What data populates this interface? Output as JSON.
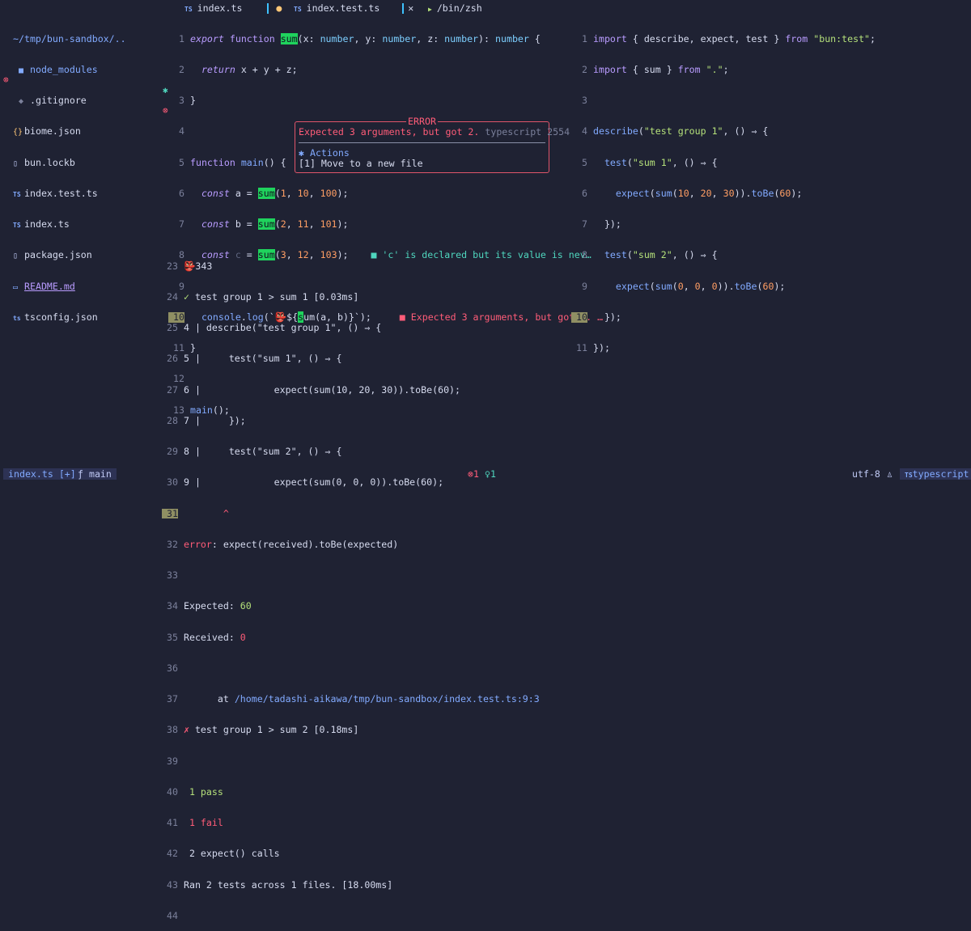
{
  "colors": {
    "background": "#1f2233",
    "error": "#ff5c78",
    "accent": "#82aaff",
    "match_highlight": "#1fd35d"
  },
  "file_tree": {
    "root": "~/tmp/bun-sandbox/..",
    "items": [
      {
        "name": "node_modules",
        "icon": "folder-icon"
      },
      {
        "name": ".gitignore",
        "icon": "git-icon"
      },
      {
        "name": "biome.json",
        "icon": "json-icon"
      },
      {
        "name": "bun.lockb",
        "icon": "file-icon"
      },
      {
        "name": "index.test.ts",
        "icon": "typescript-icon"
      },
      {
        "name": "index.ts",
        "icon": "typescript-icon"
      },
      {
        "name": "package.json",
        "icon": "file-icon"
      },
      {
        "name": "README.md",
        "icon": "markdown-icon"
      },
      {
        "name": "tsconfig.json",
        "icon": "typescript-icon"
      }
    ]
  },
  "tabs": [
    {
      "badge": "TS",
      "label": "index.ts",
      "modified": "●"
    },
    {
      "badge": "TS",
      "label": "index.test.ts",
      "close": "✕"
    },
    {
      "badge": "▶",
      "label": "/bin/zsh"
    }
  ],
  "editor_main": {
    "lines": {
      "n1": "1",
      "n2": "2",
      "n3": "3",
      "n4": "4",
      "n5": "5",
      "n6": "6",
      "n7": "7",
      "n8": "8",
      "n9": "9",
      "n10": "10",
      "n11": "11",
      "n12": "12",
      "n13": "13"
    },
    "diagnostics": {
      "hint": "■ 'c' is declared but its value is nev…",
      "error": "■ Expected 3 arguments, but got 2. …"
    }
  },
  "editor_test": {
    "lines": {
      "n1": "1",
      "n2": "2",
      "n3": "3",
      "n4": "4",
      "n5": "5",
      "n6": "6",
      "n7": "7",
      "n8": "8",
      "n9": "9",
      "n10": "10",
      "n11": "11"
    }
  },
  "popup": {
    "title": "ERROR",
    "message": "Expected 3 arguments, but got 2.",
    "source": "typescript 2554",
    "actions_label": "Actions",
    "action_1": "[1] Move to a new file"
  },
  "terminal": {
    "line_numbers": [
      "23",
      "24",
      "25",
      "26",
      "27",
      "28",
      "29",
      "30",
      "31",
      "32",
      "33",
      "34",
      "35",
      "36",
      "37",
      "38",
      "39",
      "40",
      "41",
      "42",
      "43",
      "44"
    ],
    "output_343": "343",
    "pass_test": "test group 1 > sum 1 [0.03ms]",
    "code_4": "4 | describe(\"test group 1\", () ⇒ {",
    "code_5": "5 |     test(\"sum 1\", () ⇒ {",
    "code_6": "6 |             expect(sum(10, 20, 30)).toBe(60);",
    "code_7": "7 |     });",
    "code_8": "8 |     test(\"sum 2\", () ⇒ {",
    "code_9": "9 |             expect(sum(0, 0, 0)).toBe(60);",
    "caret": "^",
    "error_line": "expect(received).toBe(expected)",
    "expected_label": "Expected:",
    "expected_value": "60",
    "received_label": "Received:",
    "received_value": "0",
    "at_prefix": "at",
    "at_path": "/home/tadashi-aikawa/tmp/bun-sandbox/index.test.ts:9:3",
    "fail_test": "test group 1 > sum 2 [0.18ms]",
    "pass_count": "1 pass",
    "fail_count": "1 fail",
    "expect_calls": "2 expect() calls",
    "summary": "Ran 2 tests across 1 files. [18.00ms]"
  },
  "statusbar": {
    "file": "index.ts [+]",
    "branch_icon": "ƒ",
    "branch": "main",
    "errors": "1",
    "hints": "1",
    "encoding": "utf-8",
    "filetype": "typescript",
    "filetype_badge": "TS"
  }
}
